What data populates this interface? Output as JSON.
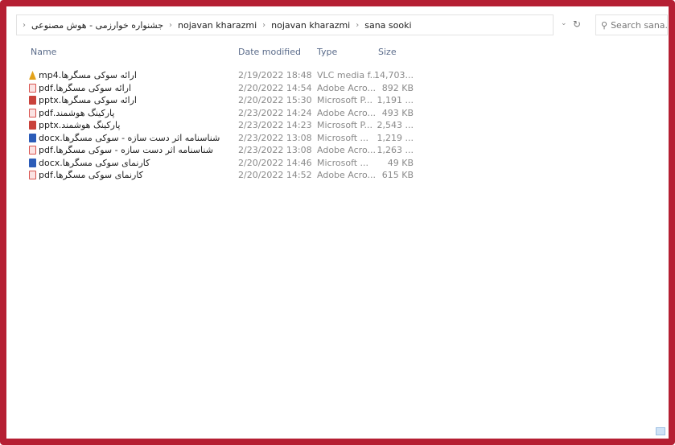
{
  "breadcrumb": [
    "جشنواره خوارزمی - هوش مصنوعی",
    "nojavan kharazmi",
    "nojavan kharazmi",
    "sana sooki"
  ],
  "search": {
    "placeholder": "Search sana..."
  },
  "columns": {
    "name": "Name",
    "date": "Date modified",
    "type": "Type",
    "size": "Size"
  },
  "files": [
    {
      "name": "ارائه سوکی مسگرها.mp4",
      "date": "2/19/2022 18:48",
      "type": "VLC media f...",
      "size": "14,703...",
      "icon": "mp4"
    },
    {
      "name": "ارائه سوکی مسگرها.pdf",
      "date": "2/20/2022 14:54",
      "type": "Adobe Acro...",
      "size": "892 KB",
      "icon": "pdf"
    },
    {
      "name": "ارائه سوکی مسگرها.pptx",
      "date": "2/20/2022 15:30",
      "type": "Microsoft P...",
      "size": "1,191 ...",
      "icon": "pptx"
    },
    {
      "name": "پارکینگ هوشمند.pdf",
      "date": "2/23/2022 14:24",
      "type": "Adobe Acro...",
      "size": "493 KB",
      "icon": "pdf"
    },
    {
      "name": "پارکینگ هوشمند.pptx",
      "date": "2/23/2022 14:23",
      "type": "Microsoft P...",
      "size": "2,543 ...",
      "icon": "pptx"
    },
    {
      "name": "شناسنامه اثر دست سازه - سوکی مسگرها.docx",
      "date": "2/23/2022 13:08",
      "type": "Microsoft ...",
      "size": "1,219 ...",
      "icon": "docx"
    },
    {
      "name": "شناسنامه اثر دست سازه - سوکی مسگرها.pdf",
      "date": "2/23/2022 13:08",
      "type": "Adobe Acro...",
      "size": "1,263 ...",
      "icon": "pdf"
    },
    {
      "name": "کارنمای سوکی مسگرها.docx",
      "date": "2/20/2022 14:46",
      "type": "Microsoft ...",
      "size": "49 KB",
      "icon": "docx"
    },
    {
      "name": "کارنمای سوکی مسگرها.pdf",
      "date": "2/20/2022 14:52",
      "type": "Adobe Acro...",
      "size": "615 KB",
      "icon": "pdf"
    }
  ],
  "colors": {
    "frame": "#b51f33",
    "header_text": "#5a6b8a"
  }
}
